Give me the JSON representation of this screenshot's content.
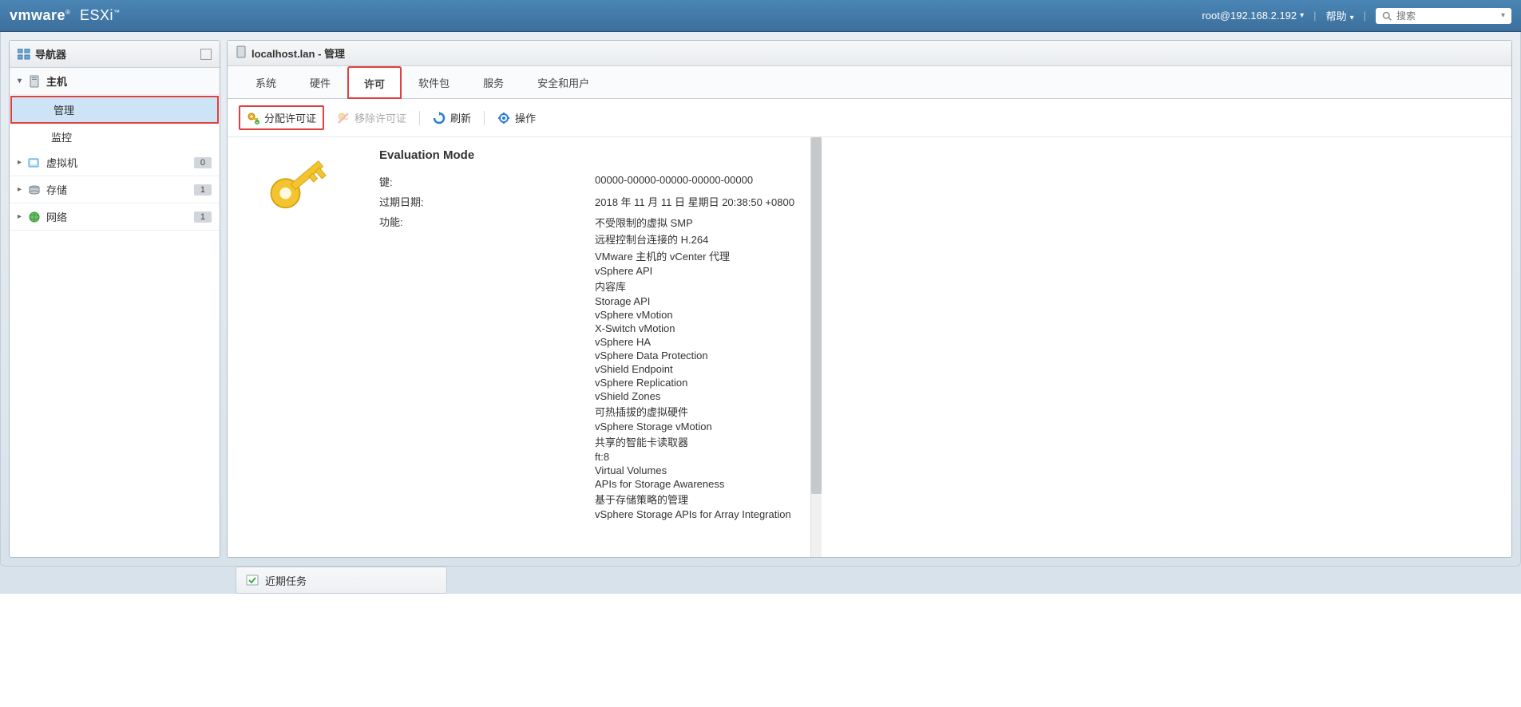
{
  "topbar": {
    "logo_brand": "vmware",
    "logo_prod": "ESXi",
    "user": "root@192.168.2.192",
    "help": "帮助",
    "search_placeholder": "搜索"
  },
  "sidebar": {
    "title": "导航器",
    "host": "主机",
    "manage": "管理",
    "monitor": "监控",
    "items": [
      {
        "label": "虚拟机",
        "count": "0"
      },
      {
        "label": "存储",
        "count": "1"
      },
      {
        "label": "网络",
        "count": "1"
      }
    ]
  },
  "panel": {
    "title": "localhost.lan - 管理"
  },
  "tabs": [
    {
      "label": "系统"
    },
    {
      "label": "硬件"
    },
    {
      "label": "许可"
    },
    {
      "label": "软件包"
    },
    {
      "label": "服务"
    },
    {
      "label": "安全和用户"
    }
  ],
  "toolbar": {
    "assign": "分配许可证",
    "remove": "移除许可证",
    "refresh": "刷新",
    "actions": "操作"
  },
  "license": {
    "mode": "Evaluation Mode",
    "labels": {
      "key": "键:",
      "expiry": "过期日期:",
      "features": "功能:"
    },
    "key": "00000-00000-00000-00000-00000",
    "expiry": "2018 年 11 月 11 日 星期日 20:38:50 +0800",
    "features": [
      "不受限制的虚拟 SMP",
      "远程控制台连接的 H.264",
      "VMware 主机的 vCenter 代理",
      "vSphere API",
      "内容库",
      "Storage API",
      "vSphere vMotion",
      "X-Switch vMotion",
      "vSphere HA",
      "vSphere Data Protection",
      "vShield Endpoint",
      "vSphere Replication",
      "vShield Zones",
      "可热插拔的虚拟硬件",
      "vSphere Storage vMotion",
      "共享的智能卡读取器",
      "ft:8",
      "Virtual Volumes",
      "APIs for Storage Awareness",
      "基于存储策略的管理",
      "vSphere Storage APIs for Array Integration"
    ]
  },
  "tasks": {
    "label": "近期任务"
  }
}
